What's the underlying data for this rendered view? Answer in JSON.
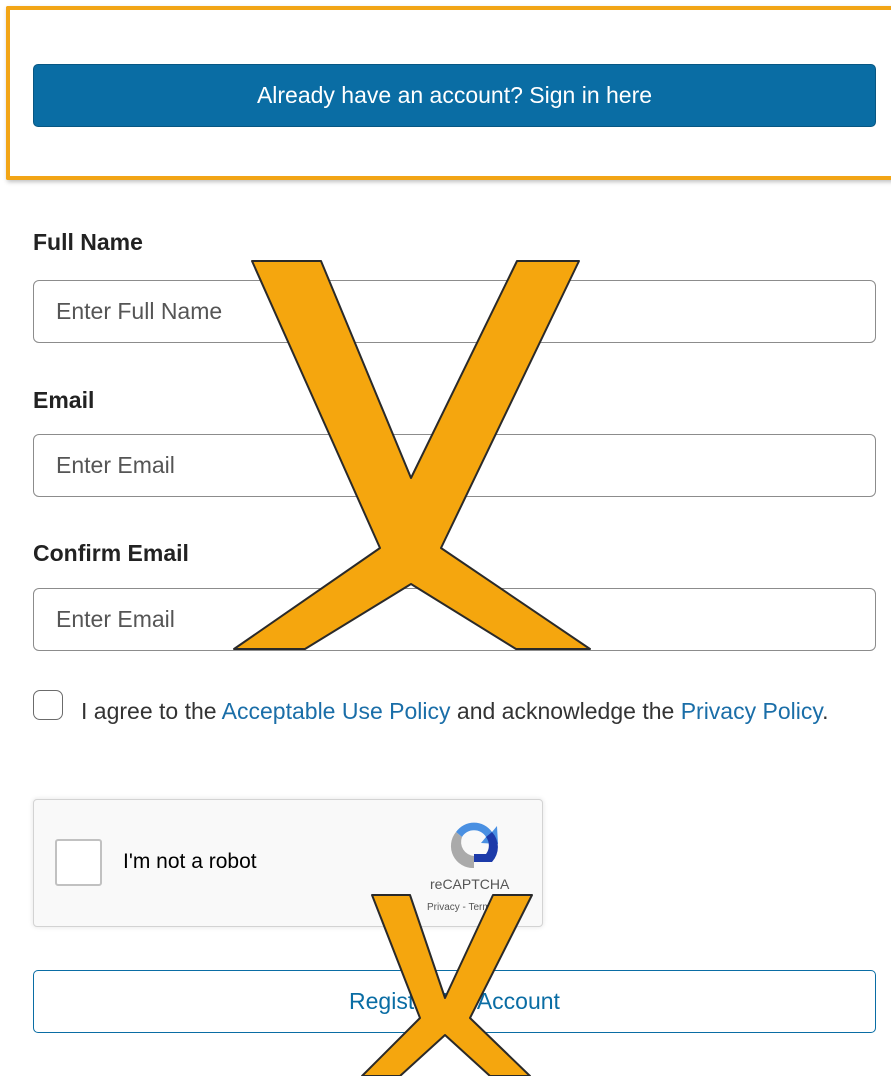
{
  "signin": {
    "button_label": "Already have an account? Sign in here"
  },
  "form": {
    "full_name": {
      "label": "Full Name",
      "placeholder": "Enter Full Name",
      "value": ""
    },
    "email": {
      "label": "Email",
      "placeholder": "Enter Email",
      "value": ""
    },
    "confirm_email": {
      "label": "Confirm Email",
      "placeholder": "Enter Email",
      "value": ""
    },
    "agreement": {
      "checked": false,
      "text_before": "I agree to the ",
      "aup_link": "Acceptable Use Policy",
      "text_middle": " and acknowledge the ",
      "privacy_link": "Privacy Policy",
      "text_after": "."
    }
  },
  "recaptcha": {
    "label": "I'm not a robot",
    "brand": "reCAPTCHA",
    "links": "Privacy - Terms"
  },
  "register": {
    "button_label": "Register My Account"
  },
  "colors": {
    "primary": "#0a6da4",
    "overlay_x": "#f2a516",
    "link": "#1a6ea8"
  },
  "icons": {
    "overlay": "x-mark-icon",
    "recaptcha": "recaptcha-logo-icon"
  }
}
